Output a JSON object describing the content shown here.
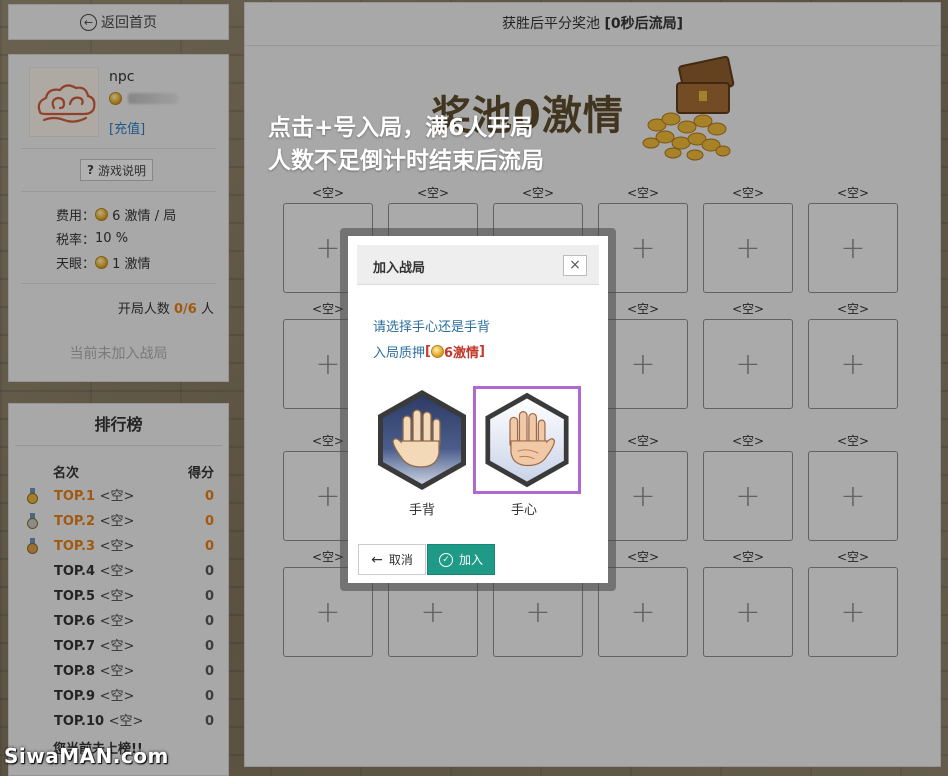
{
  "nav": {
    "back_label": "返回首页"
  },
  "user": {
    "name": "npc",
    "recharge_label": "[充值]",
    "rules_label": "游戏说明",
    "fee_label": "费用：",
    "fee_value": "6 激情 / 局",
    "tax_label": "税率：",
    "tax_value": "10 %",
    "eye_label": "天眼：",
    "eye_value": "1 激情",
    "players_label": "开局人数",
    "players_current": "0",
    "players_max": "6",
    "players_unit": "人",
    "not_joined": "当前未加入战局"
  },
  "ranking": {
    "title": "排行榜",
    "col_rank": "名次",
    "col_score": "得分",
    "rows": [
      {
        "rank": "TOP.1",
        "name": "<空>",
        "score": "0",
        "medal": "gold"
      },
      {
        "rank": "TOP.2",
        "name": "<空>",
        "score": "0",
        "medal": "silver"
      },
      {
        "rank": "TOP.3",
        "name": "<空>",
        "score": "0",
        "medal": "bronze"
      },
      {
        "rank": "TOP.4",
        "name": "<空>",
        "score": "0"
      },
      {
        "rank": "TOP.5",
        "name": "<空>",
        "score": "0"
      },
      {
        "rank": "TOP.6",
        "name": "<空>",
        "score": "0"
      },
      {
        "rank": "TOP.7",
        "name": "<空>",
        "score": "0"
      },
      {
        "rank": "TOP.8",
        "name": "<空>",
        "score": "0"
      },
      {
        "rank": "TOP.9",
        "name": "<空>",
        "score": "0"
      },
      {
        "rank": "TOP.10",
        "name": "<空>",
        "score": "0"
      }
    ],
    "footer": "您当前未上榜!!"
  },
  "main": {
    "title_prefix": "获胜后平分奖池 ",
    "title_bold": "[0秒后流局]",
    "pool_text": "奖池0激情",
    "seat_label": "<空>",
    "seat_symbol": "+"
  },
  "hint": {
    "line1": "点击+号入局，满6人开局",
    "line2": "人数不足倒计时结束后流局"
  },
  "modal": {
    "title": "加入战局",
    "close": "×",
    "prompt": "请选择手心还是手背",
    "deposit_label": "入局质押 ",
    "deposit_open": "[",
    "deposit_value": "6激情",
    "deposit_close": "]",
    "option_back": "手背",
    "option_palm": "手心",
    "selected": "手心",
    "cancel": "取消",
    "join": "加入"
  },
  "watermark": "SiwaMAN.com",
  "colors": {
    "accent_teal": "#1f9a87",
    "highlight_orange": "#e07c17",
    "link_blue": "#2b7bbd",
    "selected_purple": "#b266cf"
  }
}
